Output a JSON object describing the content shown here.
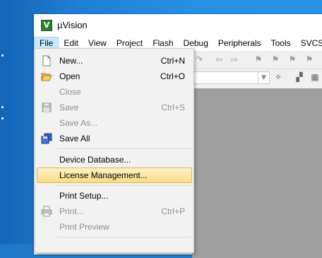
{
  "window": {
    "title": "µVision",
    "app_icon_glyph": "V"
  },
  "menubar": {
    "items": [
      "File",
      "Edit",
      "View",
      "Project",
      "Flash",
      "Debug",
      "Peripherals",
      "Tools",
      "SVCS"
    ]
  },
  "file_menu": {
    "new": {
      "label": "New...",
      "shortcut": "Ctrl+N",
      "icon": "new-file-icon"
    },
    "open": {
      "label": "Open",
      "shortcut": "Ctrl+O",
      "icon": "folder-open-icon"
    },
    "close": {
      "label": "Close"
    },
    "save": {
      "label": "Save",
      "shortcut": "Ctrl+S",
      "icon": "save-icon"
    },
    "save_as": {
      "label": "Save As..."
    },
    "save_all": {
      "label": "Save All",
      "icon": "save-all-icon"
    },
    "device_database": {
      "label": "Device Database..."
    },
    "license_management": {
      "label": "License Management..."
    },
    "print_setup": {
      "label": "Print Setup..."
    },
    "print": {
      "label": "Print...",
      "shortcut": "Ctrl+P",
      "icon": "printer-icon"
    },
    "print_preview": {
      "label": "Print Preview"
    }
  },
  "colors": {
    "menu_highlight": "#f8dc86",
    "menubar_open": "#cce8ff",
    "desktop": "#1f7fd6",
    "workspace": "#a0a0a0"
  }
}
